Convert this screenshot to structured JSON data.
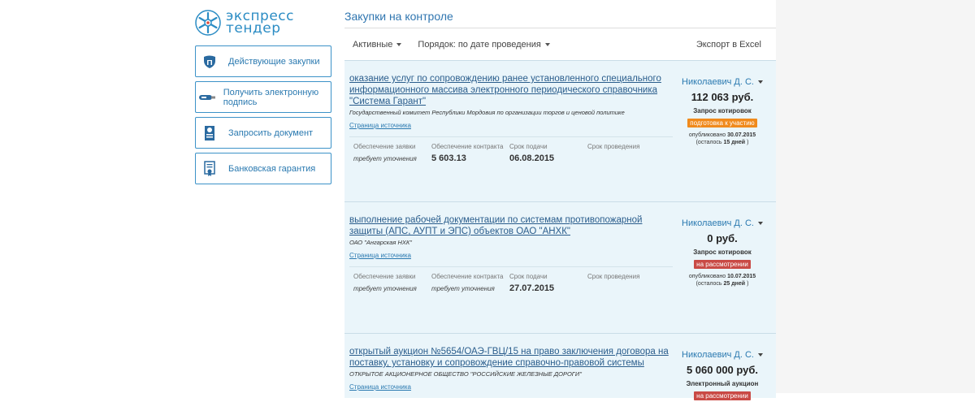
{
  "brand": {
    "line1": "экспресс",
    "line2": "тендер"
  },
  "sidebar": {
    "items": [
      {
        "label": "Действующие закупки",
        "icon": "shield-icon"
      },
      {
        "label": "Получить электронную подпись",
        "icon": "usb-token-icon"
      },
      {
        "label": "Запросить документ",
        "icon": "document-seal-icon"
      },
      {
        "label": "Банковская гарантия",
        "icon": "certificate-icon"
      }
    ]
  },
  "page": {
    "title": "Закупки на контроле"
  },
  "toolbar": {
    "filter_label": "Активные",
    "sort_label": "Порядок: по дате проведения",
    "export_label": "Экспорт в Excel"
  },
  "field_labels": {
    "deposit": "Обеспечение заявки",
    "contract_security": "Обеспечение контракта",
    "deadline": "Срок подачи",
    "hold_date": "Срок проведения"
  },
  "source_link_label": "Страница источника",
  "tenders": [
    {
      "title": "оказание услуг по сопровождению ранее установленного специального информационного массива электронного периодического справочника \"Система Гарант\"",
      "org": "Государственный комитет Республики Мордовия по организации торгов и ценовой политике",
      "deposit": "требует уточнения",
      "contract_security": "5 603.13",
      "deadline": "06.08.2015",
      "manager": "Николаевич Д. С.",
      "price": "112 063 руб.",
      "kind": "Запрос котировок",
      "status": "подготовка к участию",
      "published_label": "опубликовано",
      "published": "30.07.2015",
      "remaining_prefix": "(осталось",
      "remaining": "15 дней",
      "remaining_suffix": ")"
    },
    {
      "title": "выполнение рабочей документации по системам противопожарной защиты (АПС, АУПТ и ЭПС) объектов ОАО \"АНХК\"",
      "org": "ОАО \"Ангарская НХК\"",
      "deposit": "требует уточнения",
      "contract_security": "требует уточнения",
      "deadline": "27.07.2015",
      "manager": "Николаевич Д. С.",
      "price": "0 руб.",
      "kind": "Запрос котировок",
      "status": "на рассмотрении",
      "published_label": "опубликовано",
      "published": "10.07.2015",
      "remaining_prefix": "(осталось",
      "remaining": "25 дней",
      "remaining_suffix": ")"
    },
    {
      "title": "открытый аукцион №5654/ОАЭ-ГВЦ/15 на право заключения договора на поставку, установку и сопровождение справочно-правовой системы",
      "org": "ОТКРЫТОЕ АКЦИОНЕРНОЕ ОБЩЕСТВО \"РОССИЙСКИЕ ЖЕЛЕЗНЫЕ ДОРОГИ\"",
      "manager": "Николаевич Д. С.",
      "price": "5 060 000 руб.",
      "kind": "Электронный аукцион",
      "status": "на рассмотрении"
    }
  ],
  "colors": {
    "accent": "#2a79b0",
    "card_bg": "#eaf5fa",
    "status_orange": "#f08a1c",
    "status_red": "#c94a45"
  }
}
